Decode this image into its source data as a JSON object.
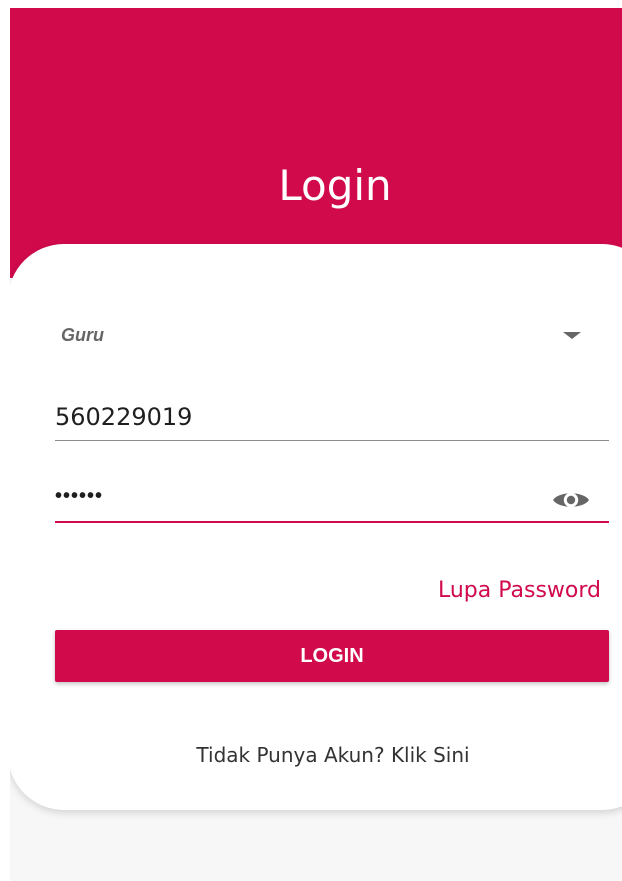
{
  "header": {
    "title": "Login"
  },
  "form": {
    "role": {
      "selected": "Guru",
      "icon": "arrow-drop-down"
    },
    "username": {
      "value": "560229019"
    },
    "password": {
      "value": "••••••",
      "toggle_icon": "eye"
    },
    "forgot_password": "Lupa Password",
    "login_button": "LOGIN",
    "signup_link": "Tidak Punya Akun? Klik Sini"
  },
  "colors": {
    "primary": "#d10a4c",
    "background": "#f7f7f7",
    "card": "#ffffff",
    "text": "#1f1f1f",
    "muted_text": "#666666",
    "underline": "#8c8c8c"
  }
}
